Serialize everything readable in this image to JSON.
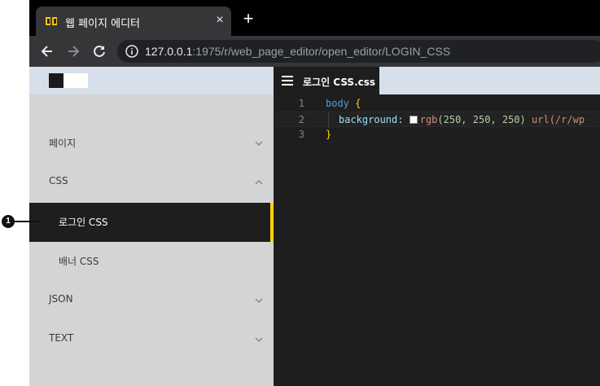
{
  "browser": {
    "tab_title": "웹 페이지 에디터",
    "close_tab_label": "×",
    "new_tab_label": "+",
    "url_host": "127.0.0.1",
    "url_rest": ":1975/r/web_page_editor/open_editor/LOGIN_CSS"
  },
  "sidebar": {
    "items": [
      {
        "label": "페이지",
        "chevron": "chevron-down-icon"
      },
      {
        "label": "CSS",
        "chevron": "chevron-up-icon"
      },
      {
        "label": "JSON",
        "chevron": "chevron-down-icon"
      },
      {
        "label": "TEXT",
        "chevron": "chevron-down-icon"
      }
    ],
    "css_children": [
      {
        "label": "로그인 CSS",
        "active": true
      },
      {
        "label": "배너 CSS",
        "active": false
      }
    ],
    "active_color": "#ffd400"
  },
  "editor": {
    "tab_label": "로그인 CSS.css",
    "lines": [
      {
        "num": "1",
        "selector": "body",
        "open": "{"
      },
      {
        "num": "2",
        "prop": "background",
        "colon": ":",
        "fn": "rgb",
        "args": "(250, 250, 250)",
        "url": "url(/r/wp"
      },
      {
        "num": "3",
        "close": "}"
      }
    ]
  },
  "annotation": {
    "number": "1"
  }
}
